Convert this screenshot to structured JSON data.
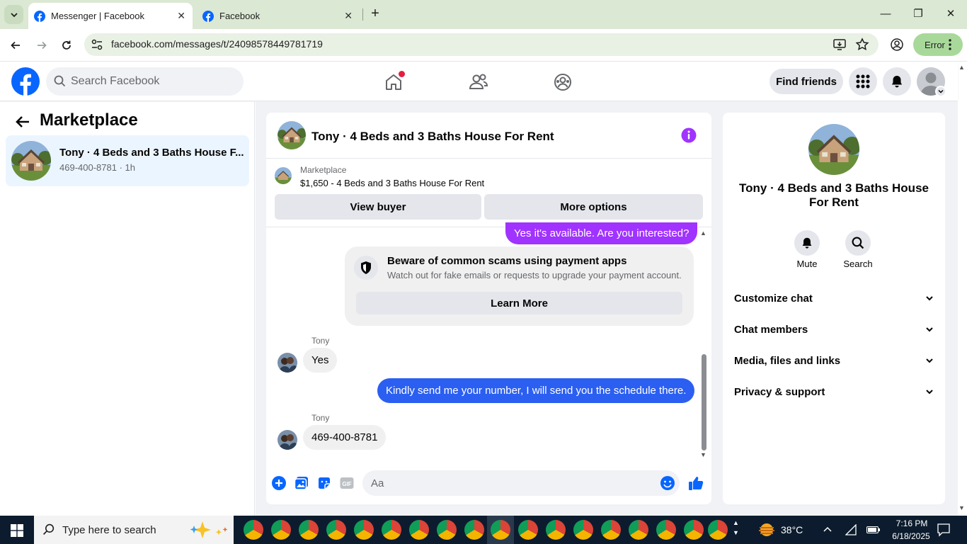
{
  "browser": {
    "tabs": [
      {
        "title": "Messenger | Facebook",
        "close": "✕"
      },
      {
        "title": "Facebook",
        "close": "✕"
      }
    ],
    "new_tab": "+",
    "url": "facebook.com/messages/t/24098578449781719",
    "profile_status": "Error",
    "window_controls": {
      "minimize": "—",
      "restore": "❐",
      "close": "✕"
    }
  },
  "fb_header": {
    "search_placeholder": "Search Facebook",
    "find_friends": "Find friends"
  },
  "left_panel": {
    "title": "Marketplace",
    "conversation": {
      "name": "Tony · 4 Beds and 3 Baths House F...",
      "subtitle": "469-400-8781 · 1h"
    }
  },
  "chat": {
    "title": "Tony · 4 Beds and 3 Baths House For Rent",
    "listing": {
      "label": "Marketplace",
      "price_line": "$1,650 - 4 Beds and 3 Baths House For Rent"
    },
    "buttons": {
      "view_buyer": "View buyer",
      "more_options": "More options"
    },
    "messages": {
      "m1": "Yes it's available. Are you interested?",
      "scam_title": "Beware of common scams using payment apps",
      "scam_sub": "Watch out for fake emails or requests to upgrade your payment account.",
      "learn_more": "Learn More",
      "sender1": "Tony",
      "m2": "Yes",
      "m3": "Kindly send me your number, I will send you the schedule there.",
      "sender2": "Tony",
      "m4": "469-400-8781"
    },
    "composer_placeholder": "Aa"
  },
  "info_panel": {
    "name": "Tony · 4 Beds and 3 Baths House For Rent",
    "mute": "Mute",
    "search": "Search",
    "sections": [
      "Customize chat",
      "Chat members",
      "Media, files and links",
      "Privacy & support"
    ]
  },
  "taskbar": {
    "search_placeholder": "Type here to search",
    "weather": "38°C",
    "time": "7:16 PM",
    "date": "6/18/2025"
  },
  "colors": {
    "fb_blue": "#0866ff",
    "outgoing_purple": "#a033ff",
    "outgoing_blue": "#2b5ff2",
    "info_purple": "#a033ff"
  }
}
